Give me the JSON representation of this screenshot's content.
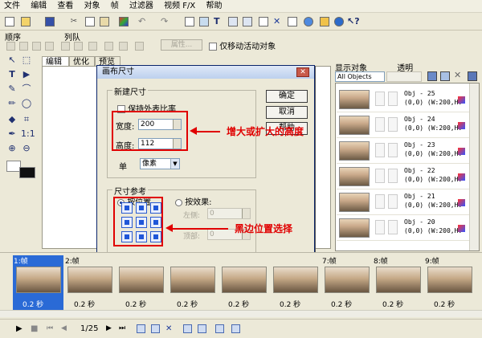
{
  "menu": [
    "文件",
    "编辑",
    "查看",
    "对象",
    "帧",
    "过滤器",
    "视频 F/X",
    "帮助"
  ],
  "toolbar2": {
    "order_label": "顺序",
    "align_label": "列队",
    "attr_button": "属性...",
    "move_active_label": "仅移动活动对象"
  },
  "tabs": [
    "编辑",
    "优化",
    "预览"
  ],
  "right_panel": {
    "show_objects_label": "显示对象",
    "transparency_label": "透明",
    "filter_value": "All Objects",
    "objects": [
      {
        "name": "Obj - 25",
        "info": "(0,0) (W:200,H:"
      },
      {
        "name": "Obj - 24",
        "info": "(0,0) (W:200,H:"
      },
      {
        "name": "Obj - 23",
        "info": "(0,0) (W:200,H:"
      },
      {
        "name": "Obj - 22",
        "info": "(0,0) (W:200,H:"
      },
      {
        "name": "Obj - 21",
        "info": "(0,0) (W:200,H:"
      },
      {
        "name": "Obj - 20",
        "info": "(0,0) (W:200,H:"
      }
    ]
  },
  "dialog": {
    "title": "画布尺寸",
    "close_symbol": "✕",
    "new_size_label": "新建尺寸",
    "keep_ratio_label": "保持外表比率",
    "width_label": "宽度:",
    "width_value": "200",
    "height_label": "高度:",
    "height_value": "112",
    "unit_label": "单",
    "unit_value": "像素",
    "ref_label": "尺寸参考",
    "by_position_label": "按位置",
    "by_effect_label": "按效果:",
    "left_label": "左侧:",
    "left_value": "0",
    "top_label": "顶部:",
    "top_value": "0",
    "ok_label": "确定",
    "cancel_label": "取消",
    "help_label": "帮助"
  },
  "annotations": {
    "size_note": "增大或扩大的高度",
    "position_note": "黑边位置选择",
    "color": "#e00000"
  },
  "frames": [
    {
      "label": "1:帧",
      "time": "0.2 秒"
    },
    {
      "label": "2:帧",
      "time": "0.2 秒"
    },
    {
      "label": "",
      "time": "0.2 秒"
    },
    {
      "label": "",
      "time": "0.2 秒"
    },
    {
      "label": "",
      "time": "0.2 秒"
    },
    {
      "label": "",
      "time": "0.2 秒"
    },
    {
      "label": "7:帧",
      "time": "0.2 秒"
    },
    {
      "label": "8:帧",
      "time": "0.2 秒"
    },
    {
      "label": "9:帧",
      "time": "0.2 秒"
    }
  ],
  "playback": {
    "position": "1/25"
  }
}
